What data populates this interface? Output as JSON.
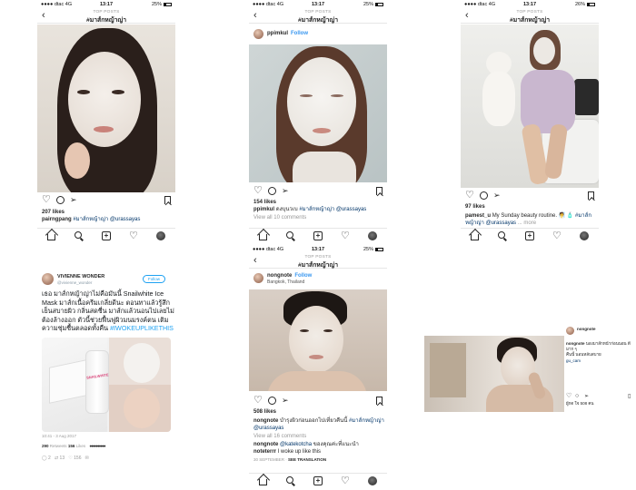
{
  "shared": {
    "carrier": "dtac",
    "network": "4G",
    "time": "13:17",
    "header_sub": "TOP POSTS",
    "header_title": "#มาส์กหญ้าญ่า",
    "back_glyph": "‹"
  },
  "posts": [
    {
      "battery": "25%",
      "likes": "207 likes",
      "caption_user": "pairngpang",
      "caption_tag": "#มาส์กหญ้าญ่า",
      "caption_mention": "@urassayas"
    },
    {
      "battery": "25%",
      "author": "ppimkul",
      "follow": "Follow",
      "likes": "154 likes",
      "caption_user": "ppimkul",
      "caption_text": "ดงบุนวเบ",
      "caption_tag": "#มาส์กหญ้าญ่า",
      "caption_mention": "@urassayas",
      "view_comments": "View all 10 comments"
    },
    {
      "battery": "26%",
      "likes": "97 likes",
      "caption_user": "pamest_u",
      "caption_text": "My Sunday beauty routine. 🧖 🧴",
      "caption_tag": "#มาส์ก",
      "caption_line2_tag": "หญ้าญ่า",
      "caption_mention": "@urassayas",
      "caption_more": "... more"
    },
    {
      "battery": "25%",
      "author": "nongnote",
      "follow": "Follow",
      "location": "Bangkok, Thailand",
      "likes": "508 likes",
      "caption_user": "nongnote",
      "caption_text": "บำรุงผิวก่อนออกไปเที่ยวคืนนี้",
      "caption_tag": "#มาส์กหญ้าญ่า",
      "caption_mention": "@urassayas",
      "view_comments": "View all 16 comments",
      "comment1_user": "nongnote",
      "comment1_mention": "@katekotcha",
      "comment1_text": "ของคุณค่ะที่แนะนำ",
      "comment2_user": "noteterrr",
      "comment2_text": "I woke up like this",
      "time_ago": "30 SEPTEMBER",
      "see_translation": "SEE TRANSLATION"
    }
  ],
  "tweet": {
    "name": "VIVIENNE WONDER",
    "handle": "@vivienne_wonder",
    "follow": "Follow",
    "body": "เธอ มาส์กหญ้าญ่าไม่คือมันนี้ Snailwhite Ice Mask มาส์กเนื้อครีมเกลี่ยดีนะ ตอนทาแล้วรู้สึกเย็นสบายผิว กลิ่นสดชื่น มาส์กแล้วนอนไปเลยไม่ต้องล้างออก ตัวนี้ช่วยฟื้นฟูผิวมนมรงค์ตน เติมความชุ่มชื้นตลอดทั้งคืน",
    "hashtag": "#IWOKEUPLIKETHIS",
    "product_label": "SNAILWHITE",
    "timestamp": "10:41 - 3 Aug 2017",
    "retweets": "290",
    "retweets_label": "Retweets",
    "likes_count": "156",
    "likes_label": "Likes",
    "reply_count": "2",
    "rt_count": "13",
    "heart_count": "156"
  },
  "landscape": {
    "user": "nongnote",
    "caption": "นองมาส์กหน้าก่อนนอน ดีมาก ๆ",
    "line2": "คืนนี้ นอนหลับสบาย",
    "mention": "gu_cam",
    "likes": "ผู้กด ใจ 508 คน"
  }
}
